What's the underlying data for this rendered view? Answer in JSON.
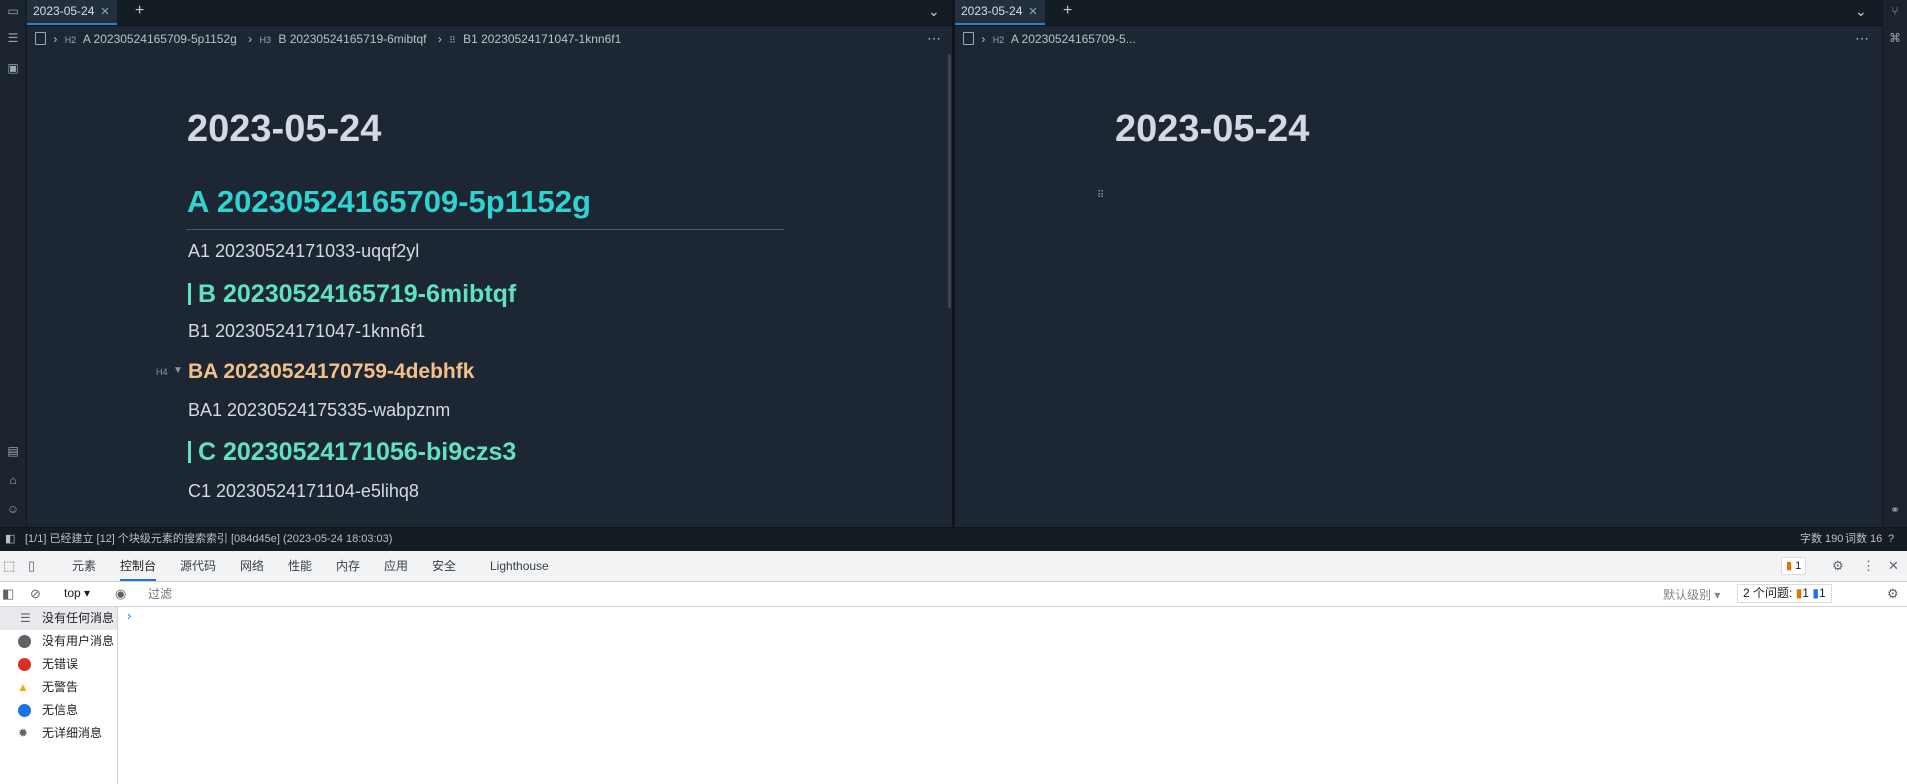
{
  "editor": {
    "left": {
      "tab": "2023-05-24",
      "breadcrumbs": [
        {
          "level": "H2",
          "text": "A 20230524165709-5p1152g"
        },
        {
          "level": "H3",
          "text": "B 20230524165719-6mibtqf"
        },
        {
          "level": "",
          "text": "B1 20230524171047-1knn6f1"
        }
      ],
      "title": "2023-05-24",
      "h2": "A 20230524165709-5p1152g",
      "a1": "A1 20230524171033-uqqf2yl",
      "h3_b": "B 20230524165719-6mibtqf",
      "b1": "B1 20230524171047-1knn6f1",
      "h4_badge": "H4",
      "h4": "BA 20230524170759-4debhfk",
      "ba1": "BA1 20230524175335-wabpznm",
      "h3_c": "C 20230524171056-bi9czs3",
      "c1": "C1 20230524171104-e5lihq8"
    },
    "right": {
      "tab": "2023-05-24",
      "breadcrumbs": [
        {
          "level": "H2",
          "text": "A 20230524165709-5..."
        }
      ],
      "title": "2023-05-24"
    }
  },
  "status": {
    "message": "[1/1] 已经建立 [12] 个块级元素的搜索索引 [084d45e] (2023-05-24 18:03:03)",
    "word_count": "字数 190",
    "term_count": "词数 16"
  },
  "devtools": {
    "tabs": [
      "元素",
      "控制台",
      "源代码",
      "网络",
      "性能",
      "内存",
      "应用",
      "安全",
      "Lighthouse"
    ],
    "active_tab": "控制台",
    "issue_badge": "1",
    "context": "top",
    "filter_placeholder": "过滤",
    "level": "默认级别",
    "issues_label": "2 个问题:",
    "issues_warn": "1",
    "issues_info": "1",
    "prompt": "›",
    "sidebar": [
      {
        "label": "没有任何消息",
        "icon": "list-icon"
      },
      {
        "label": "没有用户消息",
        "icon": "user-icon"
      },
      {
        "label": "无错误",
        "icon": "error-icon"
      },
      {
        "label": "无警告",
        "icon": "warning-icon"
      },
      {
        "label": "无信息",
        "icon": "info-icon"
      },
      {
        "label": "无详细消息",
        "icon": "bug-icon"
      }
    ]
  },
  "colors": {
    "h2": "#2fd3cf",
    "h3": "#5fe1c2",
    "h4": "#f2c089",
    "accent": "#1a73e8"
  }
}
